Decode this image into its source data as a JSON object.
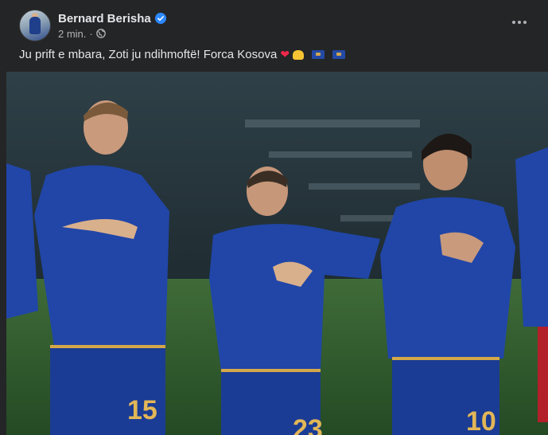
{
  "post": {
    "author": "Bernard Berisha",
    "time": "2 min.",
    "separator": "·",
    "privacy_icon": "globe-icon",
    "verified_icon": "verified-badge-icon",
    "text": "Ju prift e mbara, Zoti ju ndihmoftë! Forca Kosova",
    "emojis": [
      "red-heart",
      "raising-hands",
      "kosovo-flag",
      "kosovo-flag"
    ],
    "more_icon": "more-options-icon"
  },
  "photo": {
    "jersey_numbers": [
      "15",
      "23",
      "10"
    ]
  },
  "colors": {
    "background": "#242526",
    "text": "#e4e6eb",
    "secondary_text": "#b0b3b8",
    "verified": "#2d88ff",
    "kit_blue": "#2146a8"
  }
}
